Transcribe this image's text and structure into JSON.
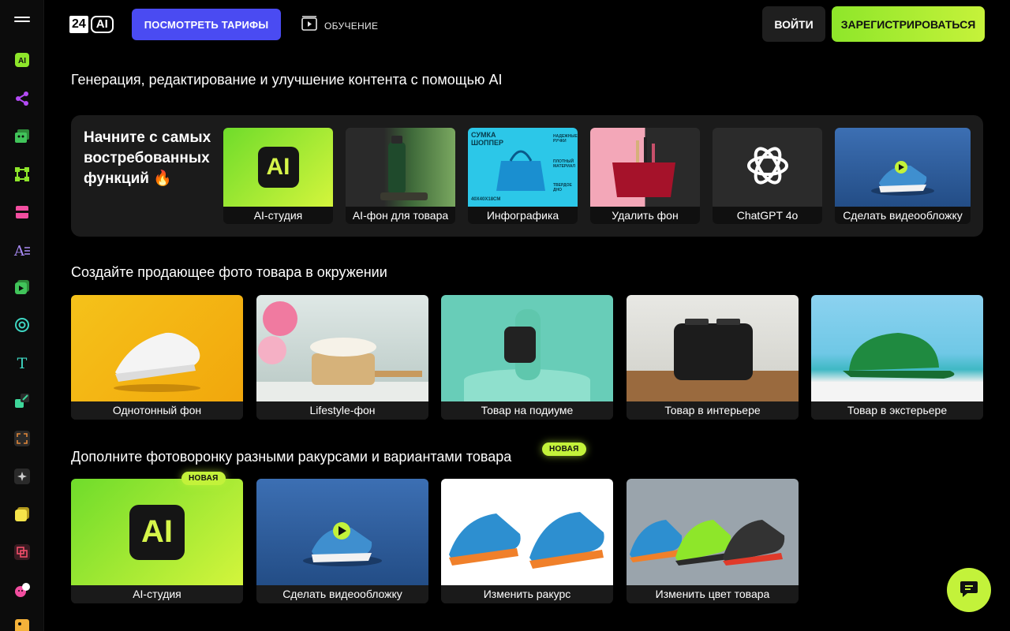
{
  "header": {
    "logo_num": "24",
    "logo_ai": "AI",
    "tariffs_label": "ПОСМОТРЕТЬ ТАРИФЫ",
    "learn_label": "ОБУЧЕНИЕ",
    "login_label": "ВОЙТИ",
    "register_label": "ЗАРЕГИСТРИРОВАТЬСЯ"
  },
  "headline": "Генерация, редактирование и улучшение контента с помощью AI",
  "popular": {
    "title": "Начните с самых востребованных функций",
    "cards": [
      {
        "label": "AI-студия",
        "thumb_text": "AI"
      },
      {
        "label": "AI-фон для товара"
      },
      {
        "label": "Инфографика",
        "thumb_text": "СУМКА ШОППЕР",
        "thumb_size": "40X40X18CM",
        "thumb_notes": [
          "НАДЕЖНЫЕ РУЧКИ",
          "ПЛОТНЫЙ МАТЕРИАЛ",
          "ТВЕРДОЕ ДНО"
        ]
      },
      {
        "label": "Удалить фон"
      },
      {
        "label": "ChatGPT 4o"
      },
      {
        "label": "Сделать видеообложку"
      }
    ]
  },
  "section1": {
    "title": "Создайте продающее фото товара в окружении",
    "cards": [
      {
        "label": "Однотонный фон"
      },
      {
        "label": "Lifestyle-фон"
      },
      {
        "label": "Товар на подиуме"
      },
      {
        "label": "Товар в интерьере"
      },
      {
        "label": "Товар в экстерьере"
      }
    ]
  },
  "section2": {
    "title": "Дополните фотоворонку разными ракурсами и вариантами товара",
    "badge": "НОВАЯ",
    "cards": [
      {
        "label": "AI-студия",
        "badge": "НОВАЯ",
        "thumb_text": "AI"
      },
      {
        "label": "Сделать видеообложку"
      },
      {
        "label": "Изменить ракурс"
      },
      {
        "label": "Изменить цвет товара"
      }
    ]
  },
  "sidebar_icons": [
    "menu-icon",
    "ai-icon",
    "share-nodes-icon",
    "image-gallery-icon",
    "vector-nodes-icon",
    "layout-icon",
    "text-format-icon",
    "video-play-icon",
    "openai-icon",
    "text-t-icon",
    "upscale-icon",
    "expand-icon",
    "sparkle-icon",
    "stack-icon",
    "replace-icon",
    "face-swap-icon",
    "photo-icon"
  ],
  "colors": {
    "accent": "#c3f23a",
    "primary_button": "#4a4bf2",
    "background": "#000000",
    "panel": "#1b1b1b"
  }
}
